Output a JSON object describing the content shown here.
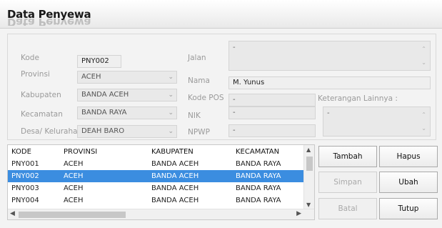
{
  "header": {
    "title": "Data Penyewa"
  },
  "form": {
    "kode": {
      "label": "Kode",
      "value": "PNY002"
    },
    "provinsi": {
      "label": "Provinsi",
      "value": "ACEH"
    },
    "kabupaten": {
      "label": "Kabupaten",
      "value": "BANDA ACEH"
    },
    "kecamatan": {
      "label": "Kecamatan",
      "value": "BANDA RAYA"
    },
    "desa": {
      "label": "Desa/ Kelurahan",
      "value": "DEAH BARO"
    },
    "jalan": {
      "label": "Jalan",
      "value": "-"
    },
    "nama": {
      "label": "Nama",
      "value": "M. Yunus"
    },
    "kode_pos": {
      "label": "Kode POS",
      "value": "-"
    },
    "nik": {
      "label": "NIK",
      "value": "-"
    },
    "npwp": {
      "label": "NPWP",
      "value": "-"
    },
    "keterangan": {
      "label": "Keterangan Lainnya :",
      "value": "-"
    }
  },
  "grid": {
    "columns": [
      "KODE",
      "PROVINSI",
      "KABUPATEN",
      "KECAMATAN"
    ],
    "rows": [
      [
        "PNY001",
        "ACEH",
        "BANDA ACEH",
        "BANDA RAYA"
      ],
      [
        "PNY002",
        "ACEH",
        "BANDA ACEH",
        "BANDA RAYA"
      ],
      [
        "PNY003",
        "ACEH",
        "BANDA ACEH",
        "BANDA RAYA"
      ],
      [
        "PNY004",
        "ACEH",
        "BANDA ACEH",
        "BANDA RAYA"
      ]
    ],
    "selected_row": 1
  },
  "buttons": {
    "tambah": "Tambah",
    "hapus": "Hapus",
    "simpan": "Simpan",
    "ubah": "Ubah",
    "batal": "Batal",
    "tutup": "Tutup"
  },
  "icons": {
    "dropdown": "chevron-down-icon",
    "scroll_up": "caret-up-icon",
    "scroll_down": "caret-down-icon",
    "scroll_left": "caret-left-icon",
    "scroll_right": "caret-right-icon"
  },
  "colors": {
    "selection": "#3b8de0"
  }
}
